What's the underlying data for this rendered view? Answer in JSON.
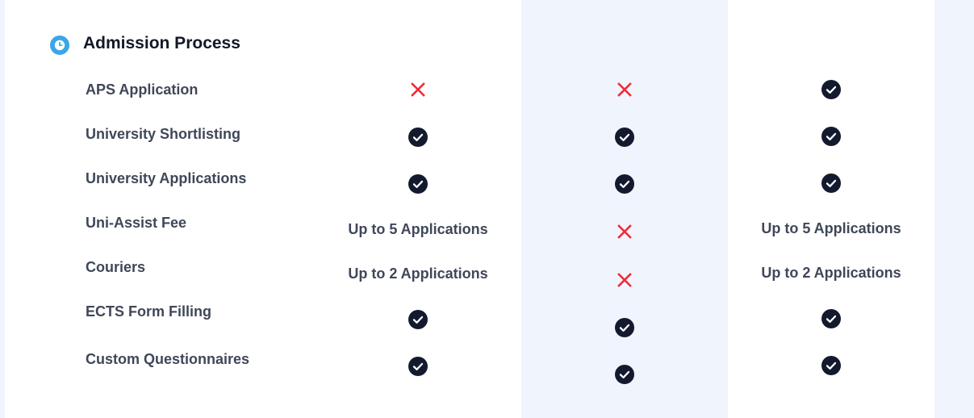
{
  "section": {
    "title": "Admission Process",
    "icon": "clock-icon",
    "icon_color": "#3aa6e8"
  },
  "colors": {
    "check": "#141a2e",
    "cross": "#ef2b3a",
    "highlight_column": "#f0f4fd"
  },
  "rows": [
    {
      "label": "APS Application",
      "values": [
        {
          "type": "cross"
        },
        {
          "type": "cross"
        },
        {
          "type": "check"
        }
      ]
    },
    {
      "label": "University Shortlisting",
      "values": [
        {
          "type": "check"
        },
        {
          "type": "check"
        },
        {
          "type": "check"
        }
      ]
    },
    {
      "label": "University Applications",
      "values": [
        {
          "type": "check"
        },
        {
          "type": "check"
        },
        {
          "type": "check"
        }
      ]
    },
    {
      "label": "Uni-Assist Fee",
      "values": [
        {
          "type": "text",
          "text": "Up to 5 Applications"
        },
        {
          "type": "cross"
        },
        {
          "type": "text",
          "text": "Up to 5 Applications"
        }
      ]
    },
    {
      "label": "Couriers",
      "values": [
        {
          "type": "text",
          "text": "Up to 2 Applications"
        },
        {
          "type": "cross"
        },
        {
          "type": "text",
          "text": "Up to 2 Applications"
        }
      ]
    },
    {
      "label": "ECTS Form Filling",
      "values": [
        {
          "type": "check"
        },
        {
          "type": "check"
        },
        {
          "type": "check"
        }
      ]
    },
    {
      "label": "Custom Questionnaires",
      "values": [
        {
          "type": "check"
        },
        {
          "type": "check"
        },
        {
          "type": "check"
        }
      ]
    }
  ]
}
